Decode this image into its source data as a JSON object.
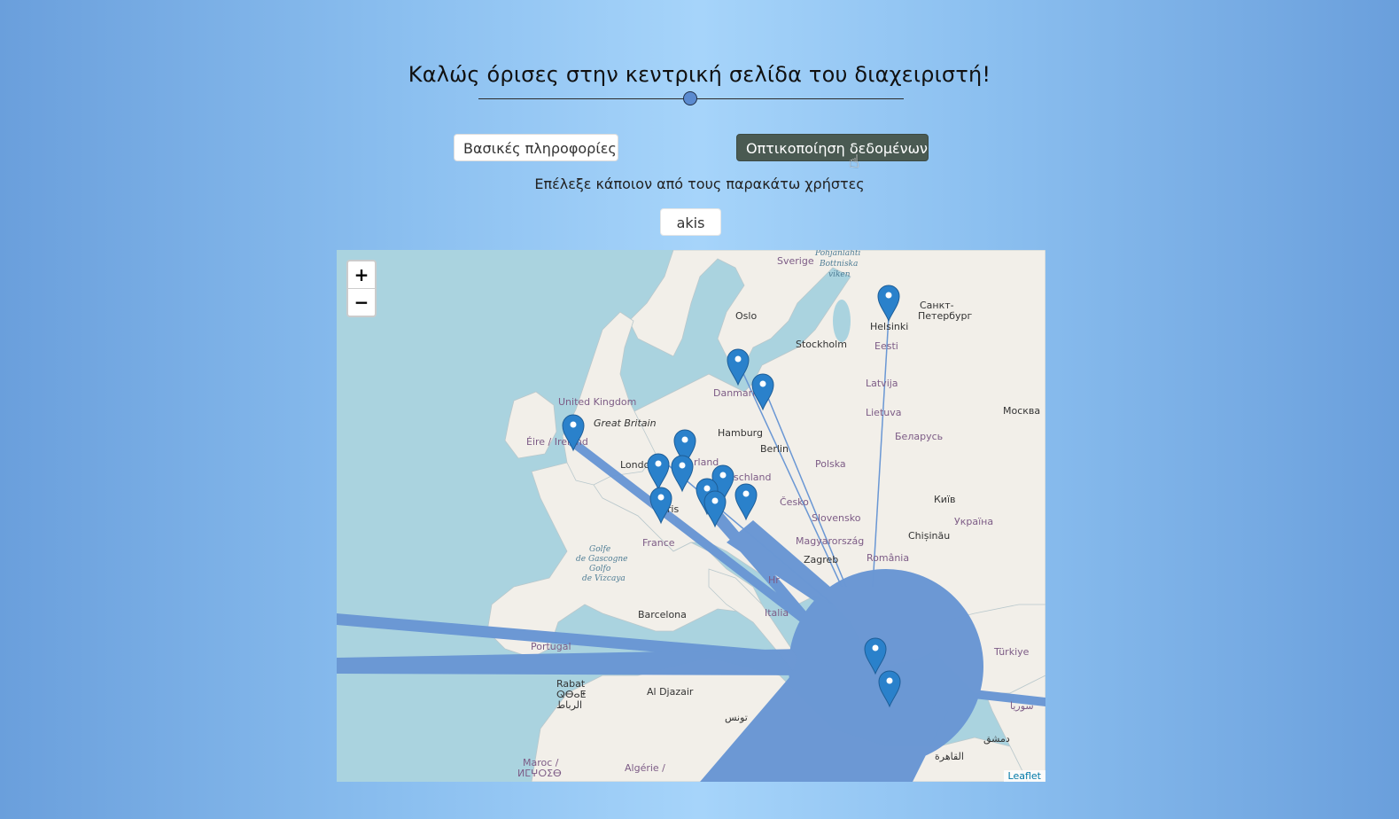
{
  "header": {
    "title": "Καλώς όρισες στην κεντρική σελίδα του διαχειριστή!"
  },
  "tabs": {
    "basic_info": "Βασικές πληροφορίες",
    "visualization": "Οπτικοποίηση δεδομένων"
  },
  "prompt": "Επέλεξε κάποιον από τους παρακάτω χρήστες",
  "users": [
    "akis"
  ],
  "map": {
    "zoom_in": "+",
    "zoom_out": "−",
    "attribution": "Leaflet",
    "marker_color": "#2a81cb",
    "flow_color": "#6a97d4",
    "labels": {
      "sverige": "Sverige",
      "pohjanlahti": "Pohjanlahti",
      "bottniska": "Bottniska",
      "viken": "viken",
      "oslo": "Oslo",
      "stockholm": "Stockholm",
      "helsinki": "Helsinki",
      "spb1": "Санкт-",
      "spb2": "Петербург",
      "eesti": "Eesti",
      "danmark": "Danmark",
      "latvija": "Latvija",
      "moskva": "Москва",
      "uk": "United Kingdom",
      "gb": "Great Britain",
      "lietuva": "Lietuva",
      "eire": "Éire / Ireland",
      "hamburg": "Hamburg",
      "belarus": "Беларусь",
      "berlin": "Berlin",
      "polska": "Polska",
      "london": "London",
      "nederland": "rland",
      "deutschland": "schland",
      "kyiv": "Київ",
      "paris": "Paris",
      "cesko": "Česko",
      "ukraina": "Україна",
      "slovensko": "Slovensko",
      "chisinau": "Chișinău",
      "france": "France",
      "magyar": "Magyarország",
      "golfe1": "Golfe",
      "golfe2": "de Gascogne",
      "golfe3": "Golfo",
      "golfe4": "de Vizcaya",
      "zagreb": "Zagreb",
      "romania": "România",
      "hr": "Hr",
      "barcelona": "Barcelona",
      "italia": "Italia",
      "portugal": "Portugal",
      "turkiye": "Türkiye",
      "rabat": "Rabat",
      "rabat2": "ⵕⴱⴰⵟ",
      "rabat3": "الرباط",
      "aldjazair": "Al Djazair",
      "suriya": "سوريا",
      "dimashq": "دمشق",
      "tunis": "تونس",
      "maroc": "Maroc /",
      "maroc2": "ⵍⵎⵖⵔⵉⴱ",
      "algerie": "Algérie /",
      "alqahira": "القاهرة"
    }
  }
}
